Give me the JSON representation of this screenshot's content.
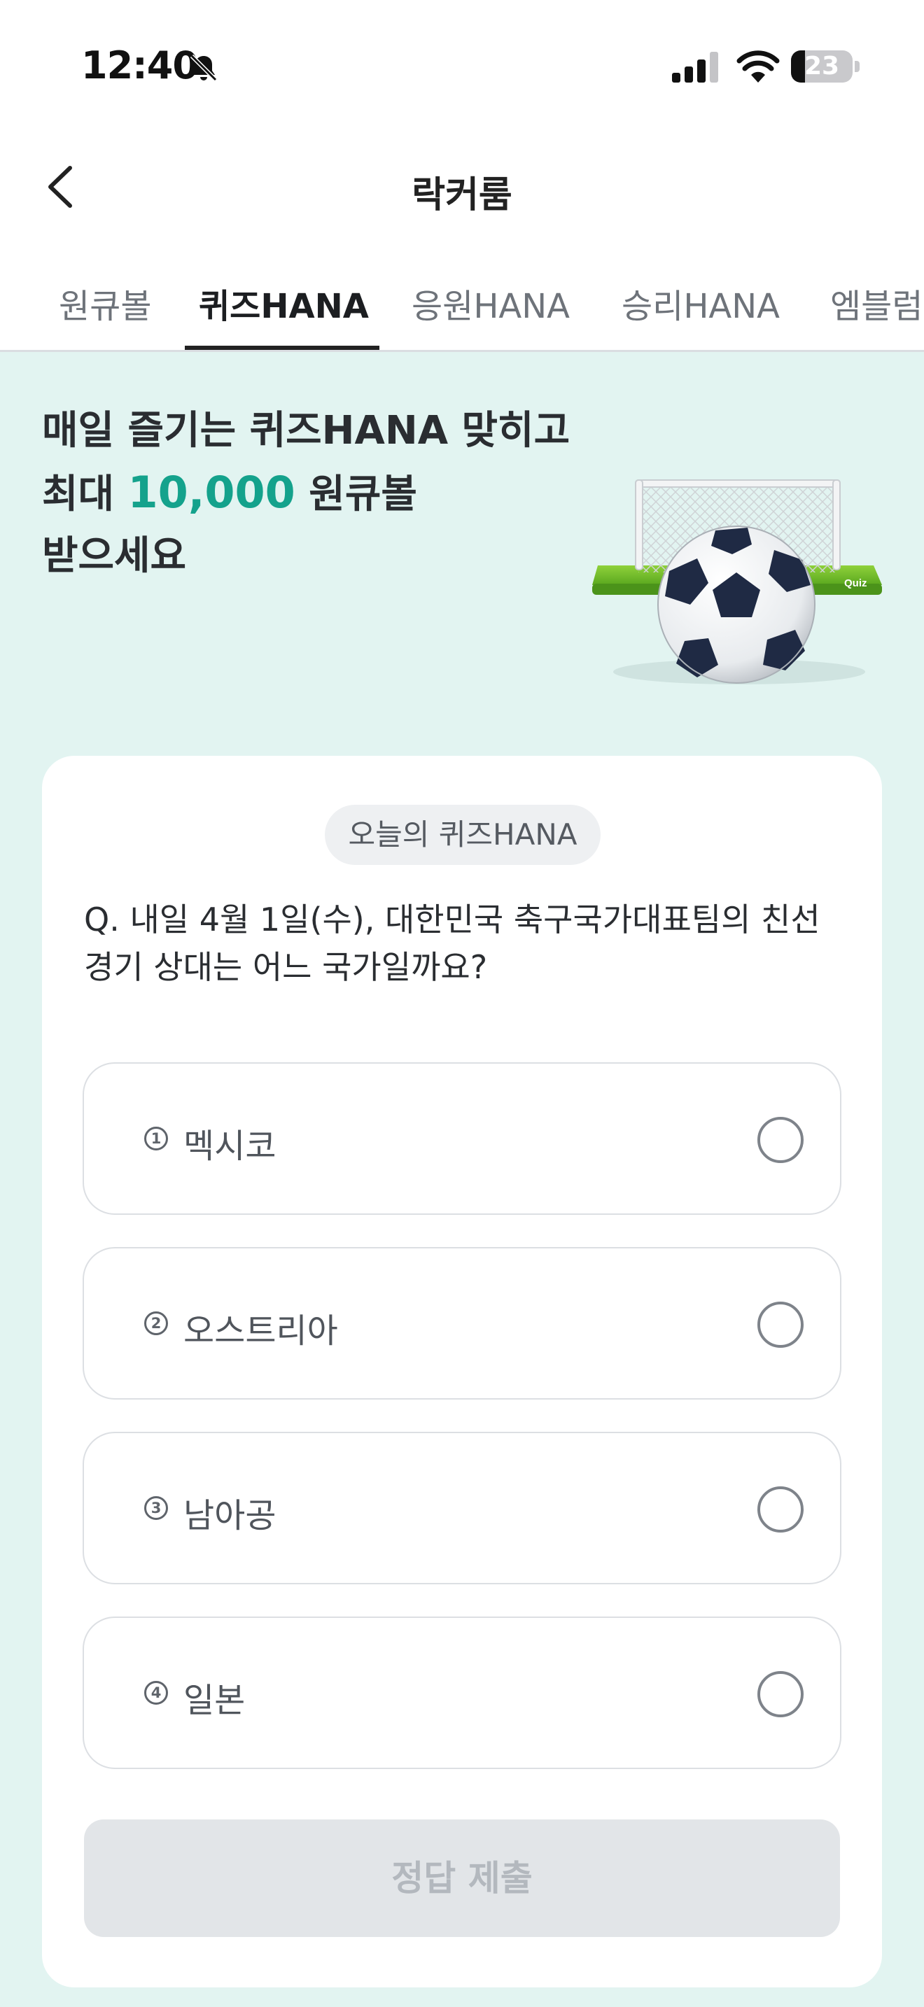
{
  "status_bar": {
    "time": "12:40",
    "battery_level": "23",
    "battery_fraction": 0.23
  },
  "header": {
    "title": "락커룸"
  },
  "tabs": [
    {
      "label": "원큐볼",
      "active": false
    },
    {
      "label": "퀴즈HANA",
      "active": true
    },
    {
      "label": "응원HANA",
      "active": false
    },
    {
      "label": "승리HANA",
      "active": false
    },
    {
      "label": "엠블럼",
      "active": false
    }
  ],
  "hero": {
    "line1": "매일 즐기는 퀴즈HANA 맞히고",
    "line2_prefix": "최대 ",
    "line2_amount": "10,000",
    "line2_suffix": " 원큐볼",
    "line3": "받으세요",
    "art_text": "Quiz"
  },
  "quiz": {
    "chip": "오늘의 퀴즈HANA",
    "question": "Q. 내일 4월 1일(수), 대한민국 축구국가대표팀의 친선경기 상대는 어느 국가일까요?",
    "options": [
      {
        "num": "1",
        "label": "멕시코",
        "selected": false
      },
      {
        "num": "2",
        "label": "오스트리아",
        "selected": false
      },
      {
        "num": "3",
        "label": "남아공",
        "selected": false
      },
      {
        "num": "4",
        "label": "일본",
        "selected": false
      }
    ],
    "submit_label": "정답 제출"
  },
  "colors": {
    "page_background": "#e2f4f1",
    "accent": "#14a28c",
    "submit_disabled_bg": "#e2e5e8",
    "submit_disabled_text": "#b3b8be"
  },
  "icons": {
    "back": "chevron-left-icon",
    "bell": "bell-slash-icon",
    "signal": "cellular-signal-icon",
    "wifi": "wifi-icon",
    "battery": "battery-icon"
  }
}
